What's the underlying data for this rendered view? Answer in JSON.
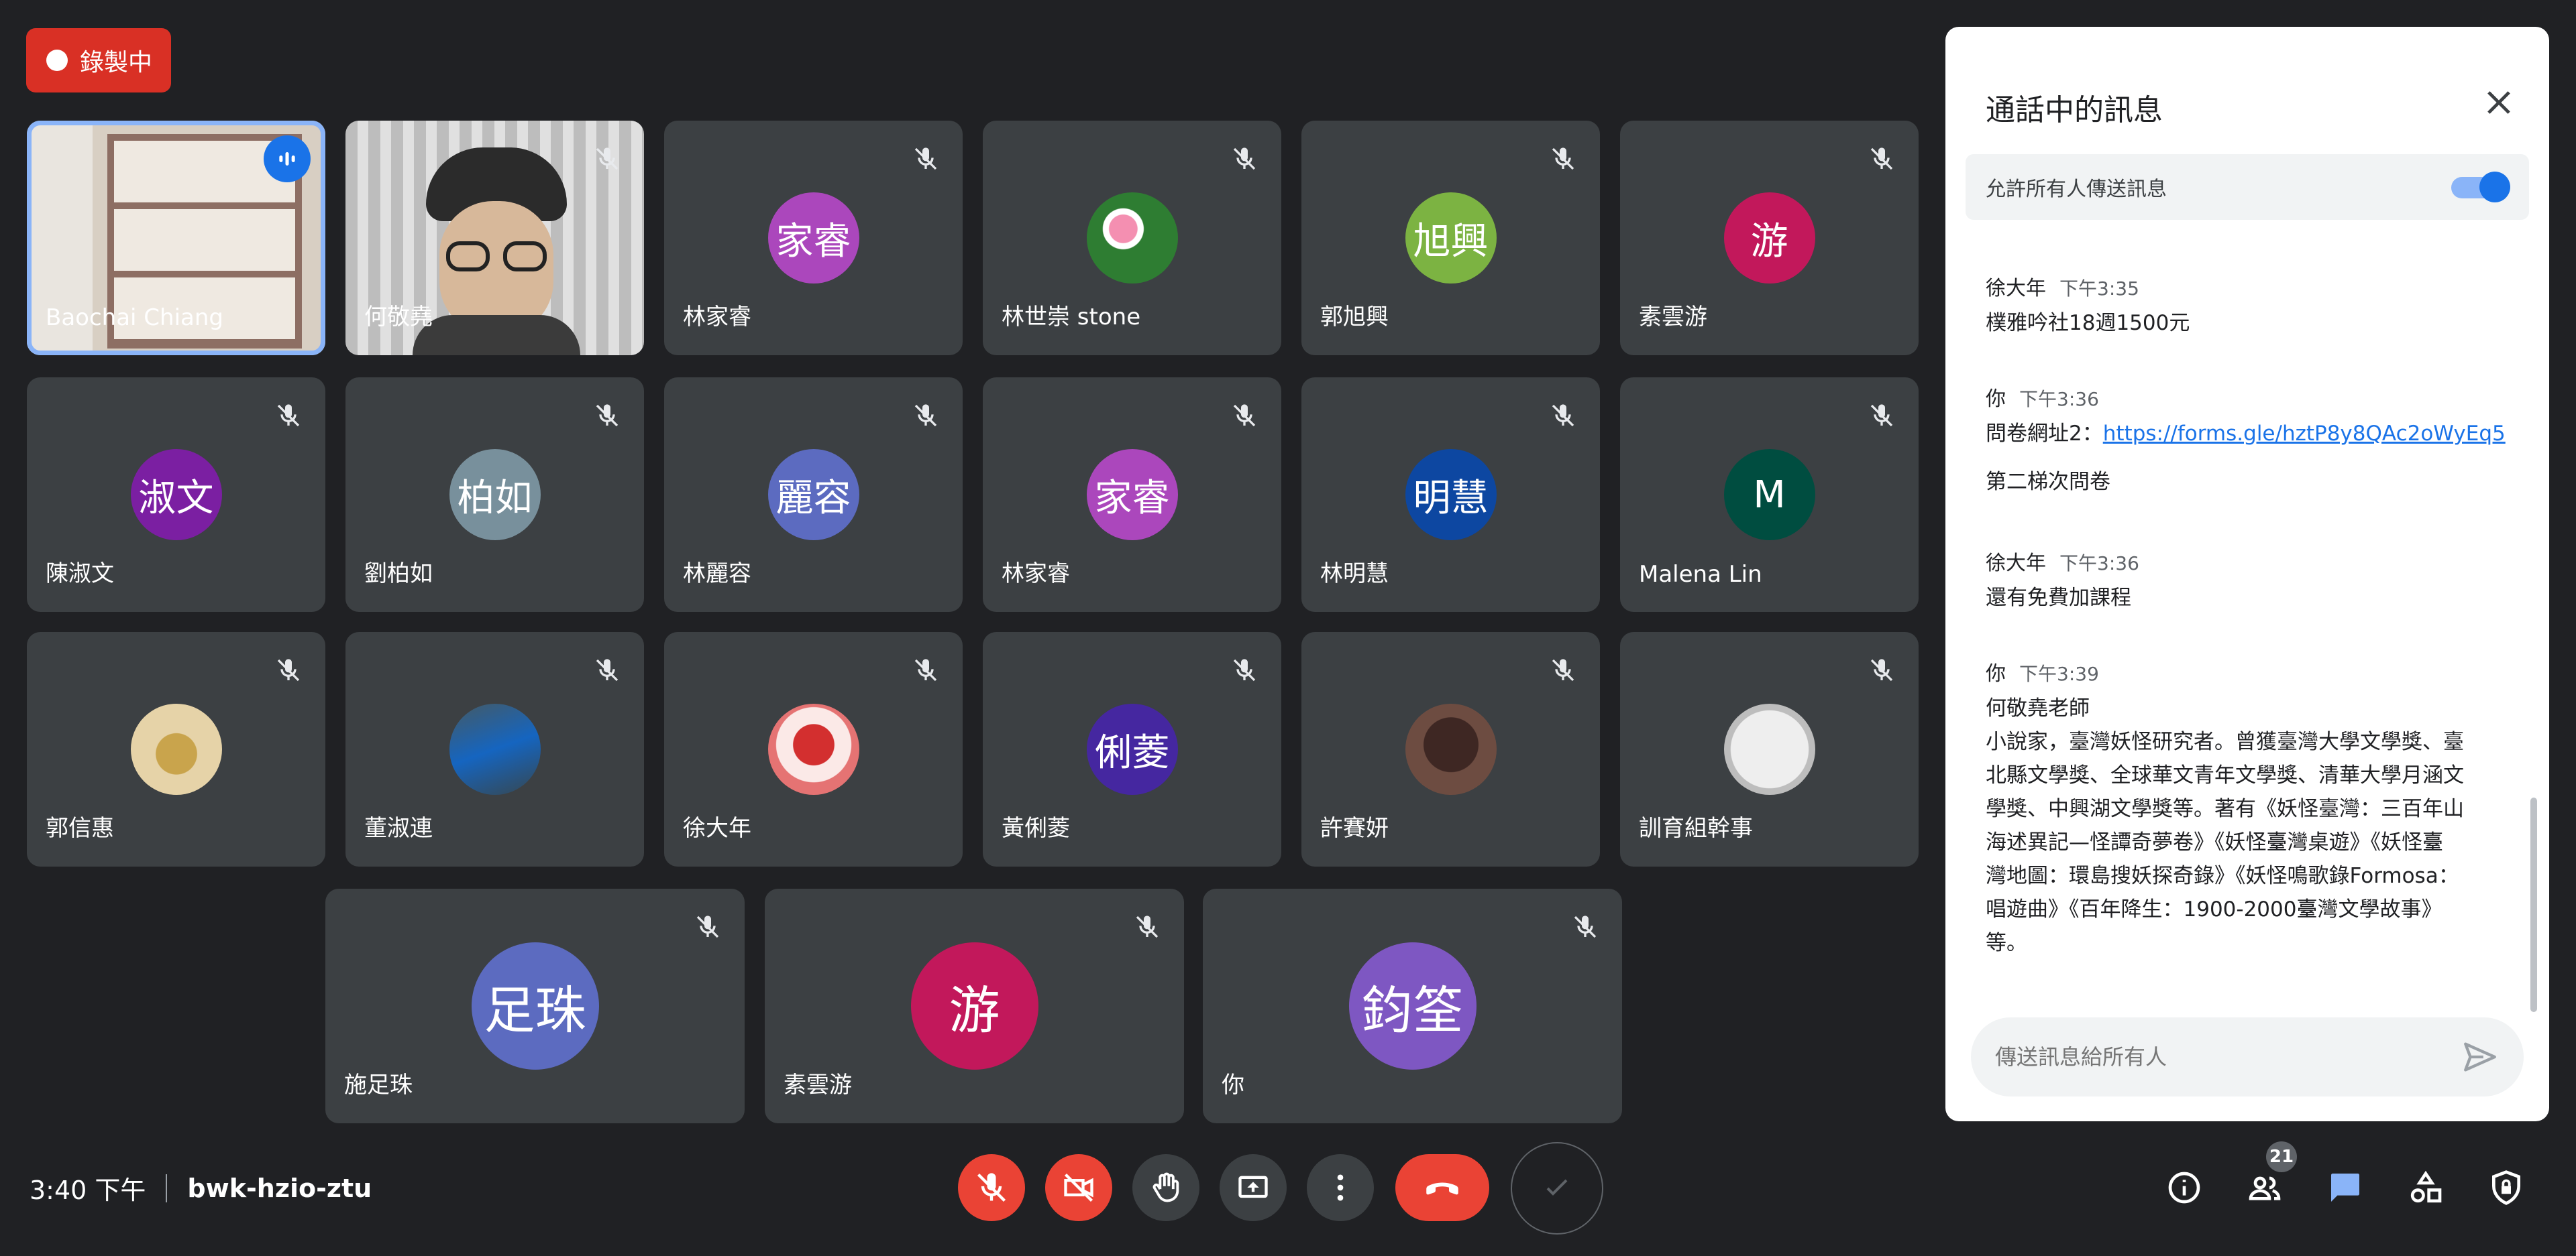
{
  "recording": {
    "label": "錄製中"
  },
  "tiles": [
    {
      "name": "Baochai Chiang",
      "avatar": "",
      "color": "",
      "x": 0
    },
    {
      "name": "何敬堯",
      "avatar": "",
      "color": ""
    },
    {
      "name": "林家睿",
      "avatar": "家睿",
      "color": "#ab47bc"
    },
    {
      "name": "林世崇 stone",
      "avatar": "",
      "color": ""
    },
    {
      "name": "郭旭興",
      "avatar": "旭興",
      "color": "#7cb342"
    },
    {
      "name": "素雲游",
      "avatar": "游",
      "color": "#c2185b"
    },
    {
      "name": "陳淑文",
      "avatar": "淑文",
      "color": "#7b1fa2"
    },
    {
      "name": "劉柏如",
      "avatar": "柏如",
      "color": "#78909c"
    },
    {
      "name": "林麗容",
      "avatar": "麗容",
      "color": "#5c6bc0"
    },
    {
      "name": "林家睿",
      "avatar": "家睿",
      "color": "#ab47bc"
    },
    {
      "name": "林明慧",
      "avatar": "明慧",
      "color": "#0d47a1"
    },
    {
      "name": "Malena Lin",
      "avatar": "M",
      "color": "#004d40"
    },
    {
      "name": "郭信惠",
      "avatar": "",
      "color": ""
    },
    {
      "name": "董淑連",
      "avatar": "",
      "color": ""
    },
    {
      "name": "徐大年",
      "avatar": "",
      "color": ""
    },
    {
      "name": "黃俐菱",
      "avatar": "俐菱",
      "color": "#4527a0"
    },
    {
      "name": "許賽妍",
      "avatar": "",
      "color": ""
    },
    {
      "name": "訓育組幹事",
      "avatar": "",
      "color": ""
    },
    {
      "name": "施足珠",
      "avatar": "足珠",
      "color": "#5c6bc0"
    },
    {
      "name": "素雲游",
      "avatar": "游",
      "color": "#c2185b"
    },
    {
      "name": "你",
      "avatar": "鈞筌",
      "color": "#7e57c2"
    }
  ],
  "meeting": {
    "time": "3:40 下午",
    "code": "bwk-hzio-ztu",
    "participant_count": "21"
  },
  "chat": {
    "title": "通話中的訊息",
    "allow_label": "允許所有人傳送訊息",
    "messages": [
      {
        "sender": "徐大年",
        "time": "下午3:35",
        "lines": [
          "樸雅吟社18週1500元"
        ]
      },
      {
        "sender": "你",
        "time": "下午3:36",
        "prefix": "問卷網址2：",
        "link": "https://forms.gle/hztP8y8QAc2oWyEq5",
        "extra": "第二梯次問卷"
      },
      {
        "sender": "徐大年",
        "time": "下午3:36",
        "lines": [
          "還有免費加課程"
        ]
      },
      {
        "sender": "你",
        "time": "下午3:39",
        "lines": [
          "何敬堯老師",
          "小說家，臺灣妖怪研究者。曾獲臺灣大學文學獎、臺",
          "北縣文學獎、全球華文青年文學獎、清華大學月涵文",
          "學獎、中興湖文學獎等。著有《妖怪臺灣：三百年山",
          "海述異記—怪譚奇夢卷》《妖怪臺灣桌遊》《妖怪臺",
          "灣地圖：環島搜妖探奇錄》《妖怪鳴歌錄Formosa：",
          "唱遊曲》《百年降生：1900-2000臺灣文學故事》",
          "等。"
        ]
      }
    ],
    "input_placeholder": "傳送訊息給所有人"
  }
}
